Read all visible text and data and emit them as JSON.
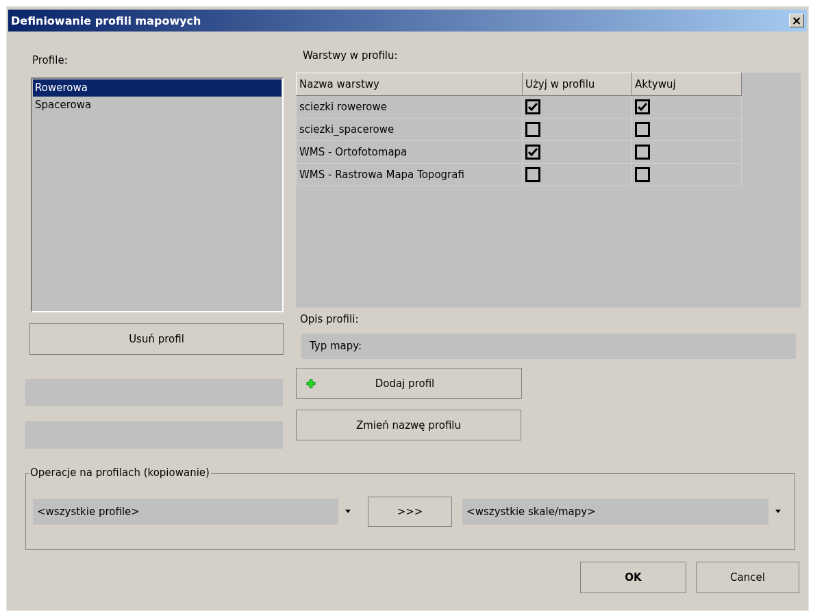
{
  "window": {
    "title": "Definiowanie profili mapowych",
    "close": "×"
  },
  "profiles": {
    "label": "Profile:",
    "items": [
      {
        "name": "Rowerowa",
        "selected": true
      },
      {
        "name": "Spacerowa",
        "selected": false
      }
    ]
  },
  "layers": {
    "label": "Warstwy w profilu:",
    "columns": [
      "Nazwa warstwy",
      "Użyj w profilu",
      "Aktywuj"
    ],
    "rows": [
      {
        "name": "sciezki rowerowe",
        "use": true,
        "activate": true
      },
      {
        "name": "sciezki_spacerowe",
        "use": false,
        "activate": false
      },
      {
        "name": "WMS - Ortofotomapa",
        "use": true,
        "activate": false
      },
      {
        "name": "WMS - Rastrowa Mapa Topografi",
        "use": false,
        "activate": false
      }
    ]
  },
  "delete_button": "Usuń profil",
  "description_label": "Opis profili:",
  "map_type": "Typ mapy:",
  "add_button": "Dodaj profil",
  "rename_button": "Zmień nazwę profilu",
  "operations": {
    "legend": "Operacje na profilach (kopiowanie)",
    "source": "<wszystkie profile>",
    "copy_button": ">>>",
    "target": "<wszystkie skale/mapy>"
  },
  "buttons": {
    "ok": "OK",
    "cancel": "Cancel"
  }
}
